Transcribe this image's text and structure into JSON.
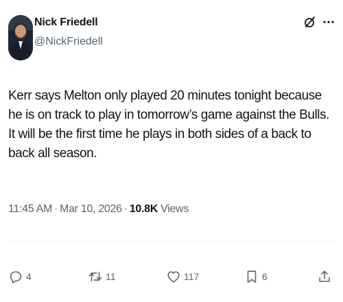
{
  "author": {
    "name": "Nick Friedell",
    "handle": "@NickFriedell"
  },
  "post": {
    "text": "Kerr says Melton only played 20 minutes tonight because he is on track to play in tomorrow’s game against the Bulls. It will be the first time he plays in both sides of a back to back all season.",
    "time": "11:45 AM",
    "date": "Mar 10, 2026",
    "views_count": "10.8K",
    "views_label": "Views"
  },
  "actions": {
    "replies": "4",
    "reposts": "11",
    "likes": "117",
    "bookmarks": "6"
  },
  "icons": {
    "grok": "grok-icon",
    "more": "more-icon",
    "reply": "reply-icon",
    "repost": "repost-icon",
    "like": "like-icon",
    "bookmark": "bookmark-icon",
    "share": "share-icon"
  },
  "colors": {
    "text": "#0f1419",
    "secondary": "#536471",
    "divider": "#eff3f4"
  }
}
